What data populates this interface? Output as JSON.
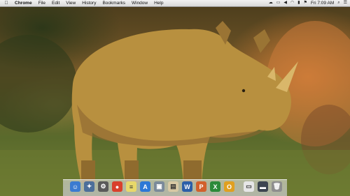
{
  "menubar": {
    "apple_icon": "apple-icon",
    "items": [
      "Chrome",
      "File",
      "Edit",
      "View",
      "History",
      "Bookmarks",
      "Window",
      "Help"
    ],
    "clock": "Fri 7:09 AM",
    "status_icons": [
      "cloud-icon",
      "display-icon",
      "volume-icon",
      "wifi-icon",
      "battery-icon",
      "flag-icon",
      "search-icon",
      "list-icon"
    ]
  },
  "dock": {
    "items": [
      {
        "name": "finder",
        "icon": "finder-icon",
        "glyph": "☺",
        "color": "#3b7bd0"
      },
      {
        "name": "safari",
        "icon": "safari-icon",
        "glyph": "✦",
        "color": "#4d6f9a"
      },
      {
        "name": "system-preferences",
        "icon": "gear-icon",
        "glyph": "⚙",
        "color": "#5a5a5a"
      },
      {
        "name": "chrome",
        "icon": "chrome-icon",
        "glyph": "●",
        "color": "#d9402c"
      },
      {
        "name": "stickies",
        "icon": "notes-icon",
        "glyph": "≡",
        "color": "#e8d86a"
      },
      {
        "name": "app-store",
        "icon": "appstore-icon",
        "glyph": "A",
        "color": "#2c78d6"
      },
      {
        "name": "preview",
        "icon": "preview-icon",
        "glyph": "▣",
        "color": "#7a8a9a"
      },
      {
        "name": "calendar",
        "icon": "calendar-icon",
        "glyph": "▤",
        "color": "#d8c9a4"
      },
      {
        "name": "word",
        "icon": "word-icon",
        "glyph": "W",
        "color": "#2b5ea8"
      },
      {
        "name": "powerpoint",
        "icon": "powerpoint-icon",
        "glyph": "P",
        "color": "#d2602c"
      },
      {
        "name": "excel",
        "icon": "excel-icon",
        "glyph": "X",
        "color": "#2c8a3a"
      },
      {
        "name": "outlook",
        "icon": "outlook-icon",
        "glyph": "O",
        "color": "#e0a020"
      },
      {
        "name": "documents",
        "icon": "document-icon",
        "glyph": "▭",
        "color": "#e6e6e6"
      },
      {
        "name": "downloads",
        "icon": "downloads-icon",
        "glyph": "▬",
        "color": "#3d4550"
      },
      {
        "name": "trash",
        "icon": "trash-icon",
        "glyph": "🗑",
        "color": "#8e8e8e"
      }
    ]
  }
}
